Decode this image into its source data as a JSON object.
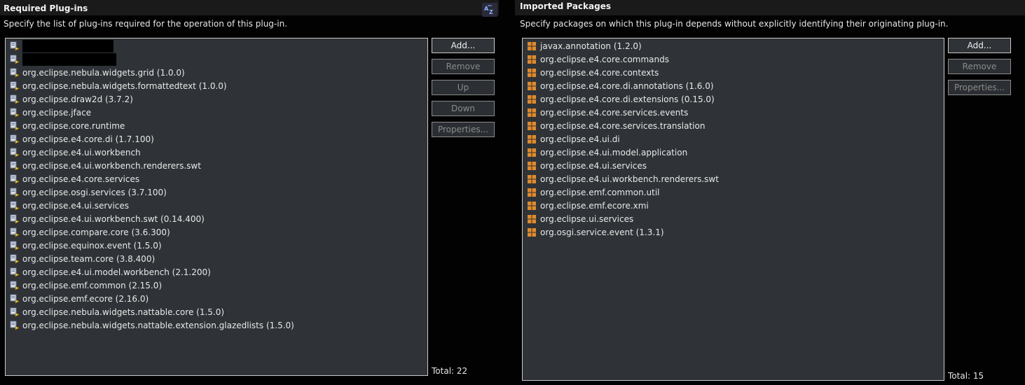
{
  "required_plugins": {
    "title": "Required Plug-ins",
    "description": "Specify the list of plug-ins required for the operation of this plug-in.",
    "sort_icon_label": "AZ",
    "items": [
      {
        "label": ""
      },
      {
        "label": ""
      },
      {
        "label": "org.eclipse.nebula.widgets.grid (1.0.0)"
      },
      {
        "label": "org.eclipse.nebula.widgets.formattedtext (1.0.0)"
      },
      {
        "label": "org.eclipse.draw2d (3.7.2)"
      },
      {
        "label": "org.eclipse.jface"
      },
      {
        "label": "org.eclipse.core.runtime"
      },
      {
        "label": "org.eclipse.e4.core.di (1.7.100)"
      },
      {
        "label": "org.eclipse.e4.ui.workbench"
      },
      {
        "label": "org.eclipse.e4.ui.workbench.renderers.swt"
      },
      {
        "label": "org.eclipse.e4.core.services"
      },
      {
        "label": "org.eclipse.osgi.services (3.7.100)"
      },
      {
        "label": "org.eclipse.e4.ui.services"
      },
      {
        "label": "org.eclipse.e4.ui.workbench.swt (0.14.400)"
      },
      {
        "label": "org.eclipse.compare.core (3.6.300)"
      },
      {
        "label": "org.eclipse.equinox.event (1.5.0)"
      },
      {
        "label": "org.eclipse.team.core (3.8.400)"
      },
      {
        "label": "org.eclipse.e4.ui.model.workbench (2.1.200)"
      },
      {
        "label": "org.eclipse.emf.common (2.15.0)"
      },
      {
        "label": "org.eclipse.emf.ecore (2.16.0)"
      },
      {
        "label": "org.eclipse.nebula.widgets.nattable.core (1.5.0)"
      },
      {
        "label": "org.eclipse.nebula.widgets.nattable.extension.glazedlists (1.5.0)"
      }
    ],
    "buttons": {
      "add": "Add...",
      "remove": "Remove",
      "up": "Up",
      "down": "Down",
      "properties": "Properties..."
    },
    "total": "Total: 22"
  },
  "imported_packages": {
    "title": "Imported Packages",
    "description": "Specify packages on which this plug-in depends without explicitly identifying their originating plug-in.",
    "items": [
      {
        "label": "javax.annotation (1.2.0)"
      },
      {
        "label": "org.eclipse.e4.core.commands"
      },
      {
        "label": "org.eclipse.e4.core.contexts"
      },
      {
        "label": "org.eclipse.e4.core.di.annotations (1.6.0)"
      },
      {
        "label": "org.eclipse.e4.core.di.extensions (0.15.0)"
      },
      {
        "label": "org.eclipse.e4.core.services.events"
      },
      {
        "label": "org.eclipse.e4.core.services.translation"
      },
      {
        "label": "org.eclipse.e4.ui.di"
      },
      {
        "label": "org.eclipse.e4.ui.model.application"
      },
      {
        "label": "org.eclipse.e4.ui.services"
      },
      {
        "label": "org.eclipse.e4.ui.workbench.renderers.swt"
      },
      {
        "label": "org.eclipse.emf.common.util"
      },
      {
        "label": "org.eclipse.emf.ecore.xmi"
      },
      {
        "label": "org.eclipse.ui.services"
      },
      {
        "label": "org.osgi.service.event (1.3.1)"
      }
    ],
    "buttons": {
      "add": "Add...",
      "remove": "Remove",
      "properties": "Properties..."
    },
    "total": "Total: 15"
  },
  "colors": {
    "background": "#020202",
    "list_background": "#2f3337",
    "package_icon": "#e08a2c",
    "plugin_icon": "#9aa7c8"
  }
}
